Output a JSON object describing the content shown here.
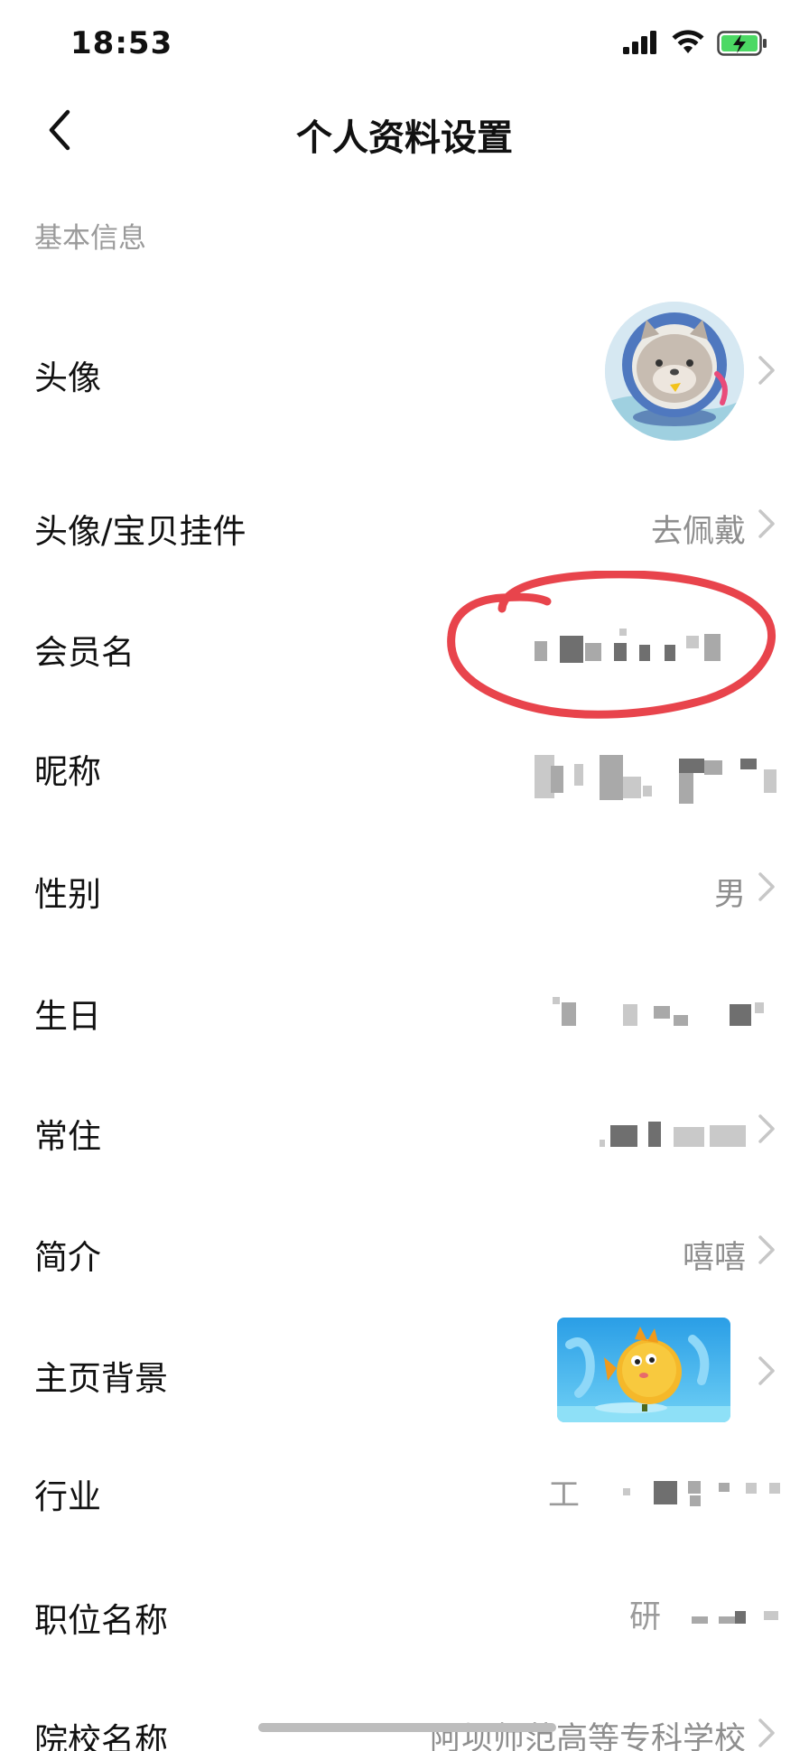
{
  "status_bar": {
    "time": "18:53",
    "signal_icon": "cellular-signal-icon",
    "wifi_icon": "wifi-icon",
    "battery_icon": "battery-charging-icon",
    "battery_color": "#4cd964"
  },
  "header": {
    "title": "个人资料设置",
    "back_icon": "chevron-left-icon"
  },
  "section": {
    "basic_info": "基本信息"
  },
  "rows": {
    "avatar": {
      "label": "头像"
    },
    "pendant": {
      "label": "头像/宝贝挂件",
      "value": "去佩戴"
    },
    "member_name": {
      "label": "会员名"
    },
    "nickname": {
      "label": "昵称"
    },
    "gender": {
      "label": "性别",
      "value": "男"
    },
    "birthday": {
      "label": "生日"
    },
    "residence": {
      "label": "常住"
    },
    "bio": {
      "label": "简介",
      "value": "嘻嘻"
    },
    "homepage_bg": {
      "label": "主页背景"
    },
    "industry": {
      "label": "行业",
      "value_prefix": "工"
    },
    "job_title": {
      "label": "职位名称",
      "value_prefix": "研"
    },
    "school": {
      "label": "院校名称",
      "value": "阿坝师范高等专科学校"
    }
  },
  "colors": {
    "annotation": "#e8444c",
    "label": "#111111",
    "value": "#8e8e8e",
    "section": "#9a9a9a"
  }
}
